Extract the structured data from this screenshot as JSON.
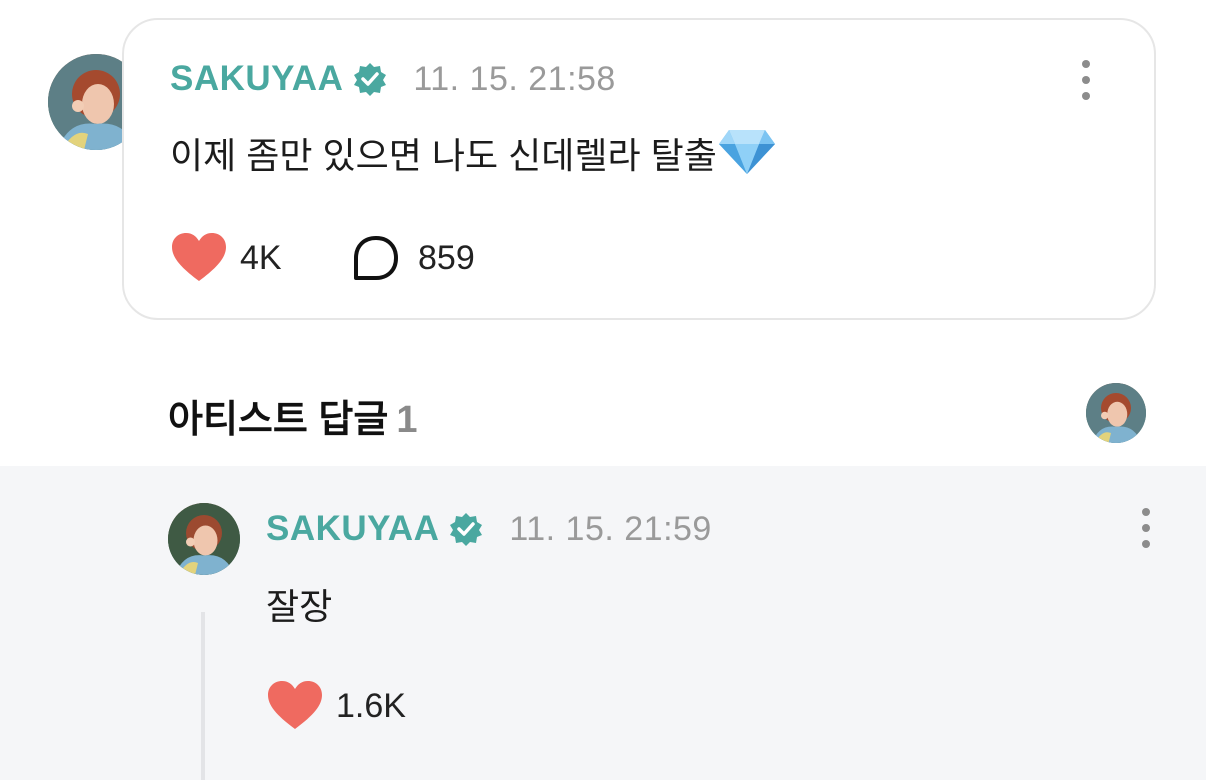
{
  "post": {
    "author": "SAKUYAA",
    "timestamp": "11. 15. 21:58",
    "text": "이제 좀만 있으면 나도 신데렐라 탈출",
    "emoji_icon": "gem-emoji",
    "likes": "4K",
    "comments": "859"
  },
  "replies_section": {
    "title": "아티스트 답글",
    "count": "1"
  },
  "reply": {
    "author": "SAKUYAA",
    "timestamp": "11. 15. 21:59",
    "text": "잘장",
    "likes": "1.6K"
  },
  "colors": {
    "author": "#4aa8a0",
    "verified": "#4aa8a0",
    "heart": "#ef6a60",
    "reply_bg": "#f5f6f8"
  }
}
